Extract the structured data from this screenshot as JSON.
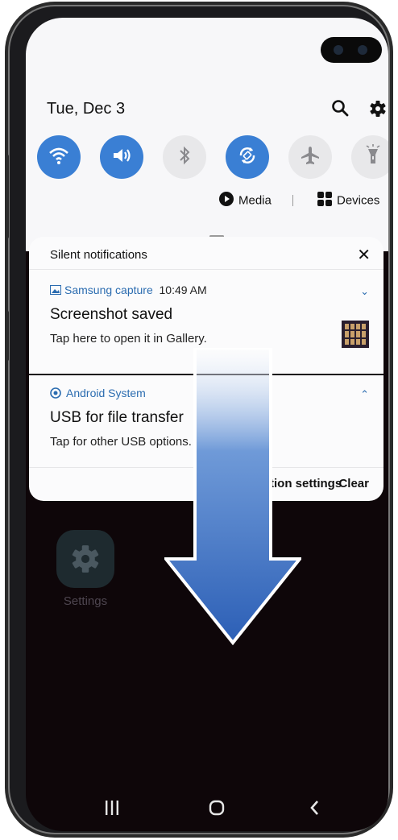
{
  "status": {
    "date": "Tue, Dec 3"
  },
  "quick_settings": [
    {
      "name": "wifi",
      "state": "on"
    },
    {
      "name": "sound",
      "state": "on"
    },
    {
      "name": "bluetooth",
      "state": "off"
    },
    {
      "name": "auto-rotate",
      "state": "on"
    },
    {
      "name": "airplane-mode",
      "state": "off"
    },
    {
      "name": "flashlight",
      "state": "off"
    }
  ],
  "media_row": {
    "media_label": "Media",
    "devices_label": "Devices"
  },
  "notifications": {
    "header": "Silent notifications",
    "items": [
      {
        "app": "Samsung capture",
        "time": "10:49 AM",
        "title": "Screenshot saved",
        "subtitle": "Tap here to open it in Gallery."
      },
      {
        "app": "Android System",
        "title": "USB for file transfer",
        "subtitle": "Tap for other USB options."
      }
    ],
    "footer": {
      "settings_label": "Notification settings",
      "clear_label": "Clear"
    }
  },
  "home": {
    "app_label": "Settings"
  },
  "colors": {
    "accent": "#3a7fd4",
    "app_name": "#2b6cb0",
    "arrow": "#3a6fc0"
  }
}
